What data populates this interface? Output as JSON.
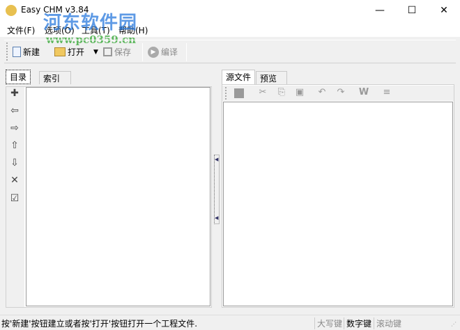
{
  "window": {
    "title": "Easy CHM v3.84",
    "minimize": "—",
    "maximize": "☐",
    "close": "✕"
  },
  "watermark": {
    "line1": "河东软件园",
    "line2": "www.pc0359.cn"
  },
  "menu": [
    "文件(F)",
    "选项(O)",
    "工具(T)",
    "帮助(H)"
  ],
  "toolbar": {
    "new": "新建",
    "open": "打开",
    "save": "保存",
    "compile": "编译"
  },
  "left": {
    "tabs": [
      "目录",
      "索引"
    ]
  },
  "right": {
    "tabs": [
      "源文件",
      "预览"
    ]
  },
  "status": {
    "message": "按'新建'按钮建立或者按'打开'按钮打开一个工程文件.",
    "caps": "大写键",
    "num": "数字键",
    "scroll": "滚动键"
  }
}
